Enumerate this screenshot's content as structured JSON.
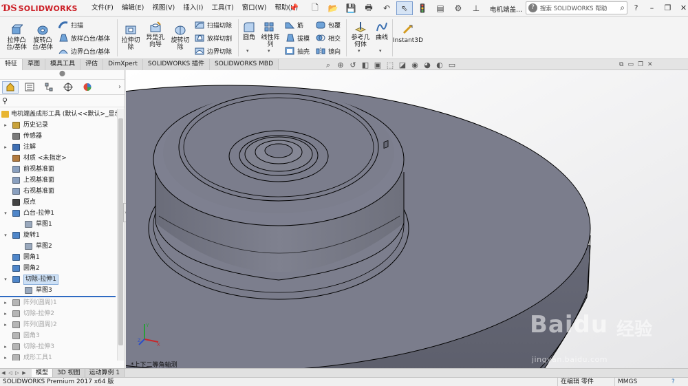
{
  "app": {
    "brand": "SOLIDWORKS",
    "document_title": "电机端盖...",
    "search_placeholder": "搜索 SOLIDWORKS 帮助"
  },
  "menu": [
    "文件(F)",
    "编辑(E)",
    "视图(V)",
    "插入(I)",
    "工具(T)",
    "窗口(W)",
    "帮助(H)"
  ],
  "ribbon": {
    "extrude_boss": "拉伸凸\n台/基体",
    "revolve_boss": "旋转凸\n台/基体",
    "sweep": "扫描",
    "loft_boss": "放样凸台/基体",
    "boundary_boss": "边界凸台/基体",
    "extrude_cut": "拉伸切\n除",
    "hole_wizard": "异型孔\n向导",
    "revolve_cut": "旋转切\n除",
    "sweep_cut": "扫描切除",
    "loft_cut": "放样切割",
    "boundary_cut": "边界切除",
    "fillet": "圆角",
    "linear_pattern": "线性阵\n列",
    "rib": "筋",
    "draft": "拔模",
    "shell": "抽壳",
    "wrap": "包覆",
    "intersect": "相交",
    "mirror": "镜向",
    "ref_geometry": "参考几\n何体",
    "curves": "曲线",
    "instant3d": "Instant3D"
  },
  "command_tabs": [
    "特征",
    "草图",
    "模具工具",
    "评估",
    "DimXpert",
    "SOLIDWORKS 插件",
    "SOLIDWORKS MBD"
  ],
  "feature_tree": {
    "root": "电机端盖成形工具 (默认<<默认>_显示",
    "items": [
      {
        "label": "历史记录",
        "indent": 0,
        "twisty": "▸",
        "icon": "history-icon",
        "color": "#c9a23a",
        "state": "normal"
      },
      {
        "label": "传感器",
        "indent": 0,
        "twisty": "",
        "icon": "sensor-icon",
        "color": "#7a7a7a",
        "state": "normal"
      },
      {
        "label": "注解",
        "indent": 0,
        "twisty": "▸",
        "icon": "annotation-icon",
        "color": "#3f6fb3",
        "state": "normal"
      },
      {
        "label": "材质 <未指定>",
        "indent": 0,
        "twisty": "",
        "icon": "material-icon",
        "color": "#b27a3e",
        "state": "normal"
      },
      {
        "label": "前视基准面",
        "indent": 0,
        "twisty": "",
        "icon": "plane-icon",
        "color": "#8aa0bf",
        "state": "normal"
      },
      {
        "label": "上视基准面",
        "indent": 0,
        "twisty": "",
        "icon": "plane-icon",
        "color": "#8aa0bf",
        "state": "normal"
      },
      {
        "label": "右视基准面",
        "indent": 0,
        "twisty": "",
        "icon": "plane-icon",
        "color": "#8aa0bf",
        "state": "normal"
      },
      {
        "label": "原点",
        "indent": 0,
        "twisty": "",
        "icon": "origin-icon",
        "color": "#444444",
        "state": "normal"
      },
      {
        "label": "凸台-拉伸1",
        "indent": 0,
        "twisty": "▾",
        "icon": "extrude-icon",
        "color": "#4f86c9",
        "state": "normal"
      },
      {
        "label": "草图1",
        "indent": 1,
        "twisty": "",
        "icon": "sketch-icon",
        "color": "#9aa9bd",
        "state": "normal"
      },
      {
        "label": "旋转1",
        "indent": 0,
        "twisty": "▾",
        "icon": "revolve-icon",
        "color": "#4f86c9",
        "state": "normal"
      },
      {
        "label": "草图2",
        "indent": 1,
        "twisty": "",
        "icon": "sketch-icon",
        "color": "#9aa9bd",
        "state": "normal"
      },
      {
        "label": "圆角1",
        "indent": 0,
        "twisty": "",
        "icon": "fillet-icon",
        "color": "#4f86c9",
        "state": "normal"
      },
      {
        "label": "圆角2",
        "indent": 0,
        "twisty": "",
        "icon": "fillet-icon",
        "color": "#4f86c9",
        "state": "normal"
      },
      {
        "label": "切除-拉伸1",
        "indent": 0,
        "twisty": "▾",
        "icon": "cut-extrude-icon",
        "color": "#4f86c9",
        "state": "selected"
      },
      {
        "label": "草图3",
        "indent": 1,
        "twisty": "",
        "icon": "sketch-icon",
        "color": "#9aa9bd",
        "state": "normal"
      },
      {
        "label": "阵列(圆周)1",
        "indent": 0,
        "twisty": "▸",
        "icon": "pattern-icon",
        "color": "#b5b5b5",
        "state": "dim"
      },
      {
        "label": "切除-拉伸2",
        "indent": 0,
        "twisty": "▸",
        "icon": "cut-extrude-icon",
        "color": "#b5b5b5",
        "state": "dim"
      },
      {
        "label": "阵列(圆周)2",
        "indent": 0,
        "twisty": "▸",
        "icon": "pattern-icon",
        "color": "#b5b5b5",
        "state": "dim"
      },
      {
        "label": "圆角3",
        "indent": 0,
        "twisty": "",
        "icon": "fillet-icon",
        "color": "#b5b5b5",
        "state": "dim"
      },
      {
        "label": "切除-拉伸3",
        "indent": 0,
        "twisty": "▸",
        "icon": "cut-extrude-icon",
        "color": "#b5b5b5",
        "state": "dim"
      },
      {
        "label": "成形工具1",
        "indent": 0,
        "twisty": "▸",
        "icon": "form-tool-icon",
        "color": "#b5b5b5",
        "state": "dim"
      }
    ]
  },
  "viewport": {
    "view_name": "*上下二等角轴测",
    "axis_labels": {
      "x": "X",
      "y": "Y",
      "z": "Z"
    }
  },
  "watermark": {
    "brand": "Baidu",
    "brand_cn": "经验",
    "url": "jingyan.baidu.com"
  },
  "bottom_tabs": [
    "模型",
    "3D 视图",
    "运动算例 1"
  ],
  "status": {
    "left": "SOLIDWORKS Premium 2017 x64 版",
    "mode": "在编辑 零件",
    "units": "MMGS",
    "help": "?"
  },
  "colors": {
    "model_face": "#7b7d8c",
    "model_edge": "#000000",
    "brand_red": "#cc1f26",
    "selection": "#cde0f5",
    "rollback": "#2e6ac2"
  }
}
